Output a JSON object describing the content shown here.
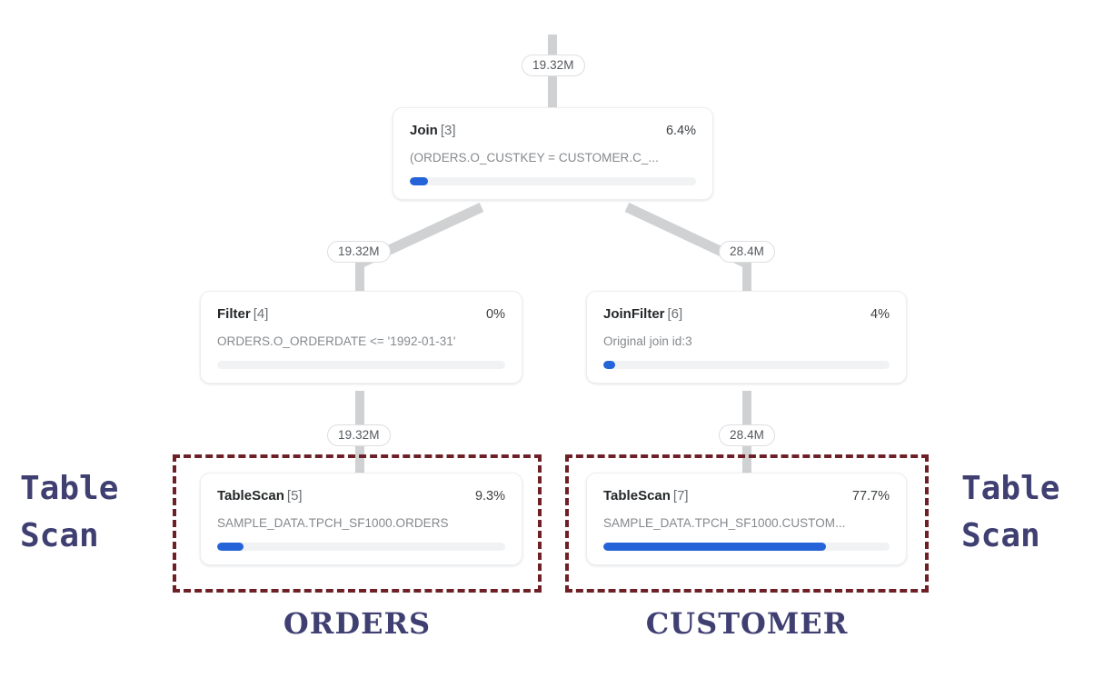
{
  "diagram": {
    "title": "Query profile operator tree",
    "colors": {
      "bar_fill": "#2563d8",
      "bar_track": "#f1f2f3",
      "edge": "#cfd1d3",
      "annotation_box": "#6e2026",
      "annotation_text": "#3f3f72",
      "card_border": "#eceef0"
    }
  },
  "edges": [
    {
      "name": "root-out",
      "label": "19.32M"
    },
    {
      "name": "join-to-filter",
      "label": "19.32M"
    },
    {
      "name": "join-to-joinfilter",
      "label": "28.4M"
    },
    {
      "name": "filter-to-tablescan-orders",
      "label": "19.32M"
    },
    {
      "name": "joinfilter-to-tablescan-customer",
      "label": "28.4M"
    }
  ],
  "nodes": [
    {
      "id": "join-3",
      "operator": "Join",
      "index": "[3]",
      "percent": "6.4%",
      "detail": "(ORDERS.O_CUSTKEY = CUSTOMER.C_...",
      "bar_percent": 6.4
    },
    {
      "id": "filter-4",
      "operator": "Filter",
      "index": "[4]",
      "percent": "0%",
      "detail": "ORDERS.O_ORDERDATE <= '1992-01-31'",
      "bar_percent": 0
    },
    {
      "id": "joinfilter-6",
      "operator": "JoinFilter",
      "index": "[6]",
      "percent": "4%",
      "detail": "Original join id:3",
      "bar_percent": 4
    },
    {
      "id": "tablescan-5",
      "operator": "TableScan",
      "index": "[5]",
      "percent": "9.3%",
      "detail": "SAMPLE_DATA.TPCH_SF1000.ORDERS",
      "bar_percent": 9.3
    },
    {
      "id": "tablescan-7",
      "operator": "TableScan",
      "index": "[7]",
      "percent": "77.7%",
      "detail": "SAMPLE_DATA.TPCH_SF1000.CUSTOM...",
      "bar_percent": 77.7
    }
  ],
  "annotations": {
    "left_note": "Table\nScan",
    "right_note": "Table\nScan",
    "left_caption": "ORDERS",
    "right_caption": "CUSTOMER"
  }
}
